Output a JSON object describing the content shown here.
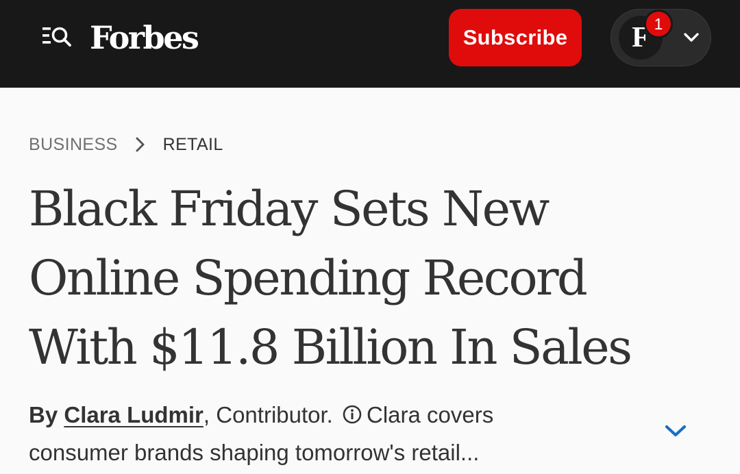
{
  "header": {
    "logo_text": "Forbes",
    "subscribe_label": "Subscribe",
    "account": {
      "avatar_letter": "F",
      "notification_count": "1"
    },
    "icons": {
      "menu_search": "menu-search-icon",
      "account_dropdown": "chevron-down-icon"
    }
  },
  "breadcrumb": {
    "items": [
      "BUSINESS",
      "RETAIL"
    ],
    "separator_icon": "chevron-right-icon"
  },
  "article": {
    "headline_lines": [
      "Black Friday Sets New",
      "Online Spending Record",
      "With $11.8 Billion In Sales"
    ],
    "byline": {
      "by": "By",
      "author": "Clara Ludmir",
      "comma": ",",
      "role": "Contributor.",
      "bio_start": "Clara covers",
      "bio_continued": "consumer brands shaping tomorrow's retail..."
    },
    "icons": {
      "info": "info-icon",
      "expand": "chevron-down-icon"
    }
  },
  "colors": {
    "header_bg": "#181818",
    "subscribe_red": "#e00b0b",
    "page_bg": "#fafafa",
    "text": "#333333",
    "muted": "#707070",
    "link_blue": "#1a6fc4"
  }
}
